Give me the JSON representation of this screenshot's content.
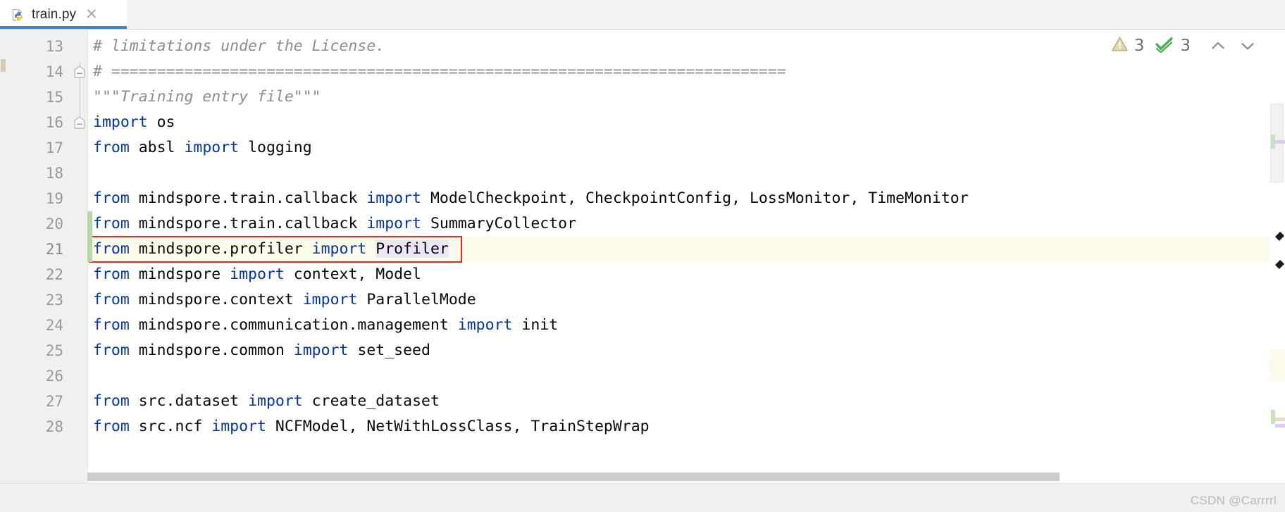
{
  "tab": {
    "label": "train.py",
    "icon": "python-file-icon",
    "close_icon": "close-icon"
  },
  "inspection": {
    "warning_icon": "warning-triangle-icon",
    "warning_count": "3",
    "ok_icon": "green-double-check-icon",
    "ok_count": "3",
    "prev_icon": "chevron-up-icon",
    "next_icon": "chevron-down-icon"
  },
  "editor": {
    "first_line": 13,
    "lines": [
      {
        "num": "13",
        "fold": null,
        "change": false,
        "highlight": false,
        "tokens": [
          {
            "cls": "cmt",
            "text": "# limitations under the License."
          }
        ]
      },
      {
        "num": "14",
        "fold": "collapse",
        "change": false,
        "highlight": false,
        "tokens": [
          {
            "cls": "cmt",
            "text": "# =========================================================================="
          }
        ]
      },
      {
        "num": "15",
        "fold": null,
        "change": false,
        "highlight": false,
        "tokens": [
          {
            "cls": "str",
            "text": "\"\"\"Training entry file\"\"\""
          }
        ]
      },
      {
        "num": "16",
        "fold": "collapse",
        "change": false,
        "highlight": false,
        "tokens": [
          {
            "cls": "kw",
            "text": "import"
          },
          {
            "cls": "plain",
            "text": " os"
          }
        ]
      },
      {
        "num": "17",
        "fold": null,
        "change": false,
        "highlight": false,
        "tokens": [
          {
            "cls": "kw",
            "text": "from"
          },
          {
            "cls": "plain",
            "text": " absl "
          },
          {
            "cls": "kw",
            "text": "import"
          },
          {
            "cls": "plain",
            "text": " logging"
          }
        ]
      },
      {
        "num": "18",
        "fold": null,
        "change": false,
        "highlight": false,
        "tokens": []
      },
      {
        "num": "19",
        "fold": null,
        "change": false,
        "highlight": false,
        "tokens": [
          {
            "cls": "kw",
            "text": "from"
          },
          {
            "cls": "plain",
            "text": " mindspore.train.callback "
          },
          {
            "cls": "kw",
            "text": "import"
          },
          {
            "cls": "plain",
            "text": " ModelCheckpoint, CheckpointConfig, LossMonitor, TimeMonitor"
          }
        ]
      },
      {
        "num": "20",
        "fold": null,
        "change": true,
        "highlight": false,
        "tokens": [
          {
            "cls": "kw",
            "text": "from"
          },
          {
            "cls": "plain",
            "text": " mindspore.train.callback "
          },
          {
            "cls": "kw",
            "text": "import"
          },
          {
            "cls": "plain",
            "text": " SummaryCollector"
          }
        ]
      },
      {
        "num": "21",
        "fold": null,
        "change": true,
        "highlight": true,
        "tokens": [
          {
            "cls": "kw",
            "text": "from"
          },
          {
            "cls": "plain",
            "text": " mindspore.profiler "
          },
          {
            "cls": "kw",
            "text": "import"
          },
          {
            "cls": "plain",
            "text": " "
          },
          {
            "cls": "ident-hl",
            "text": "Profiler"
          }
        ]
      },
      {
        "num": "22",
        "fold": null,
        "change": false,
        "highlight": false,
        "tokens": [
          {
            "cls": "kw",
            "text": "from"
          },
          {
            "cls": "plain",
            "text": " mindspore "
          },
          {
            "cls": "kw",
            "text": "import"
          },
          {
            "cls": "plain",
            "text": " context, Model"
          }
        ]
      },
      {
        "num": "23",
        "fold": null,
        "change": false,
        "highlight": false,
        "tokens": [
          {
            "cls": "kw",
            "text": "from"
          },
          {
            "cls": "plain",
            "text": " mindspore.context "
          },
          {
            "cls": "kw",
            "text": "import"
          },
          {
            "cls": "plain",
            "text": " ParallelMode"
          }
        ]
      },
      {
        "num": "24",
        "fold": null,
        "change": false,
        "highlight": false,
        "tokens": [
          {
            "cls": "kw",
            "text": "from"
          },
          {
            "cls": "plain",
            "text": " mindspore.communication.management "
          },
          {
            "cls": "kw",
            "text": "import"
          },
          {
            "cls": "plain",
            "text": " init"
          }
        ]
      },
      {
        "num": "25",
        "fold": null,
        "change": false,
        "highlight": false,
        "tokens": [
          {
            "cls": "kw",
            "text": "from"
          },
          {
            "cls": "plain",
            "text": " mindspore.common "
          },
          {
            "cls": "kw",
            "text": "import"
          },
          {
            "cls": "plain",
            "text": " set_seed"
          }
        ]
      },
      {
        "num": "26",
        "fold": null,
        "change": false,
        "highlight": false,
        "tokens": []
      },
      {
        "num": "27",
        "fold": null,
        "change": false,
        "highlight": false,
        "tokens": [
          {
            "cls": "kw",
            "text": "from"
          },
          {
            "cls": "plain",
            "text": " src.dataset "
          },
          {
            "cls": "kw",
            "text": "import"
          },
          {
            "cls": "plain",
            "text": " create_dataset"
          }
        ]
      },
      {
        "num": "28",
        "fold": null,
        "change": false,
        "highlight": false,
        "tokens": [
          {
            "cls": "kw",
            "text": "from"
          },
          {
            "cls": "plain",
            "text": " src.ncf "
          },
          {
            "cls": "kw",
            "text": "import"
          },
          {
            "cls": "plain",
            "text": " NCFModel, NetWithLossClass, TrainStepWrap"
          }
        ]
      }
    ]
  },
  "annotation": {
    "red_box_target_line": "21",
    "red_box_color": "#e8291c"
  },
  "watermark": {
    "text": "CSDN @Carrrrl"
  },
  "colors": {
    "keyword": "#0033b3",
    "comment": "#8c8c8c",
    "highlight_row": "#fcfae8",
    "identifier_highlight": "#ece6f7",
    "tab_underline": "#4083c9",
    "vcs_change": "#b9d6a8"
  }
}
